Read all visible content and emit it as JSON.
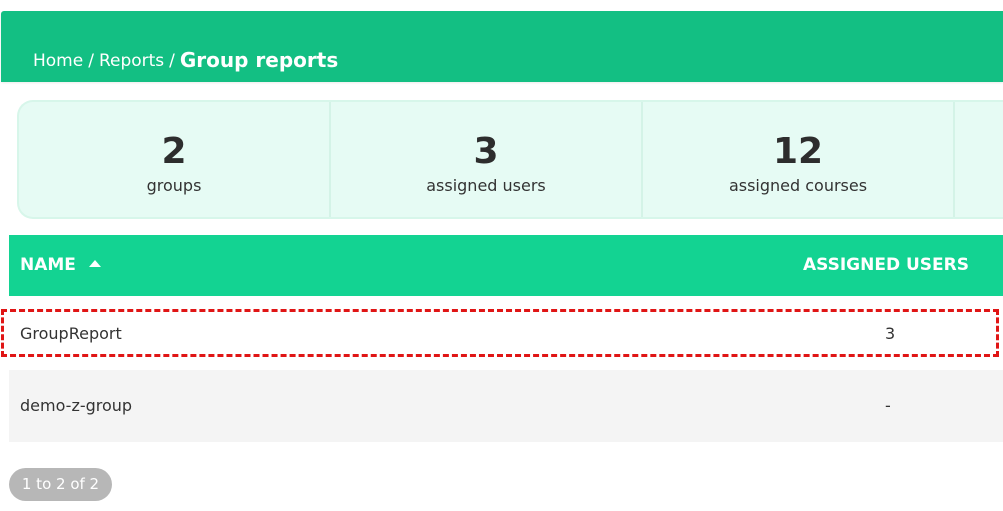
{
  "header": {
    "breadcrumb": [
      {
        "label": "Home"
      },
      {
        "label": "Reports"
      }
    ],
    "separator": "/",
    "current": "Group reports"
  },
  "stats": [
    {
      "value": "2",
      "label": "groups"
    },
    {
      "value": "3",
      "label": "assigned users"
    },
    {
      "value": "12",
      "label": "assigned courses"
    }
  ],
  "table": {
    "columns": {
      "name": "NAME",
      "assigned_users": "ASSIGNED USERS"
    },
    "sort_icon": "caret-up-icon",
    "rows": [
      {
        "name": "GroupReport",
        "assigned_users": "3"
      },
      {
        "name": "demo-z-group",
        "assigned_users": "-"
      }
    ]
  },
  "pagination": {
    "summary": "1 to 2 of 2"
  },
  "colors": {
    "header_bg": "#13bf83",
    "table_head_bg": "#13d392",
    "stats_bg": "#e6fbf4",
    "highlight": "#e01515",
    "pager_bg": "#b7b7b7"
  }
}
